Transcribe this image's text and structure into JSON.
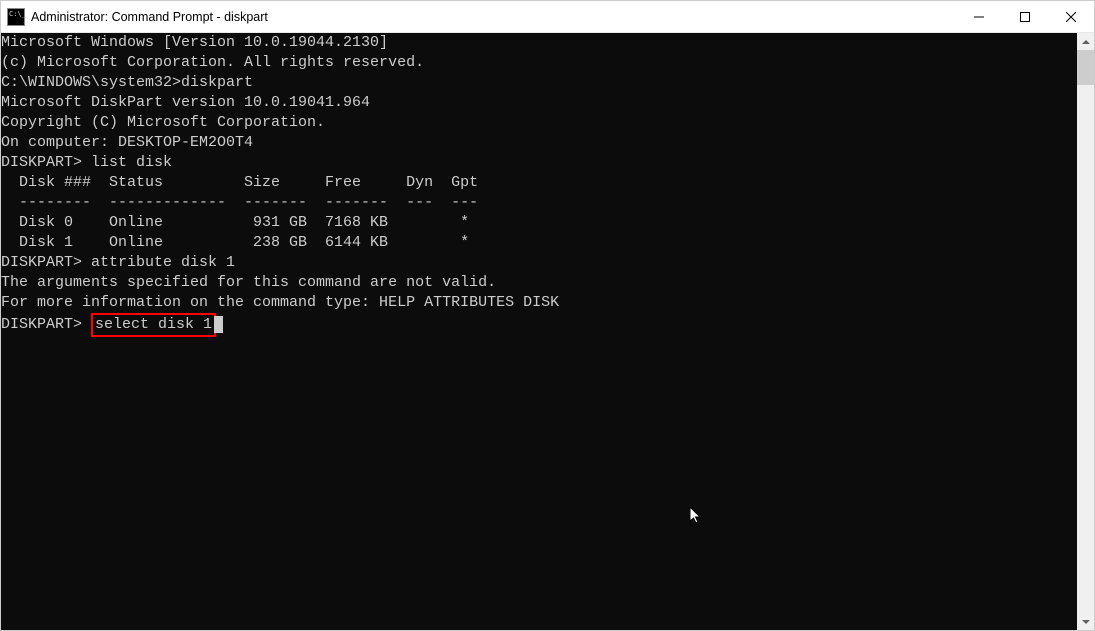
{
  "titlebar": {
    "title": "Administrator: Command Prompt - diskpart"
  },
  "terminal": {
    "line1": "Microsoft Windows [Version 10.0.19044.2130]",
    "line2": "(c) Microsoft Corporation. All rights reserved.",
    "line3": "",
    "line4_prompt": "C:\\WINDOWS\\system32>",
    "line4_cmd": "diskpart",
    "line5": "",
    "line6": "Microsoft DiskPart version 10.0.19041.964",
    "line7": "",
    "line8": "Copyright (C) Microsoft Corporation.",
    "line9": "On computer: DESKTOP-EM2O0T4",
    "line10": "",
    "line11_prompt": "DISKPART> ",
    "line11_cmd": "list disk",
    "line12": "",
    "table_header": "  Disk ###  Status         Size     Free     Dyn  Gpt",
    "table_divider": "  --------  -------------  -------  -------  ---  ---",
    "table_row1": "  Disk 0    Online          931 GB  7168 KB        *",
    "table_row2": "  Disk 1    Online          238 GB  6144 KB        *",
    "line17": "",
    "line18_prompt": "DISKPART> ",
    "line18_cmd": "attribute disk 1",
    "line19": "",
    "line20": "The arguments specified for this command are not valid.",
    "line21": "For more information on the command type: HELP ATTRIBUTES DISK",
    "line22": "",
    "line23_prompt": "DISKPART> ",
    "line23_cmd": "select disk 1"
  }
}
